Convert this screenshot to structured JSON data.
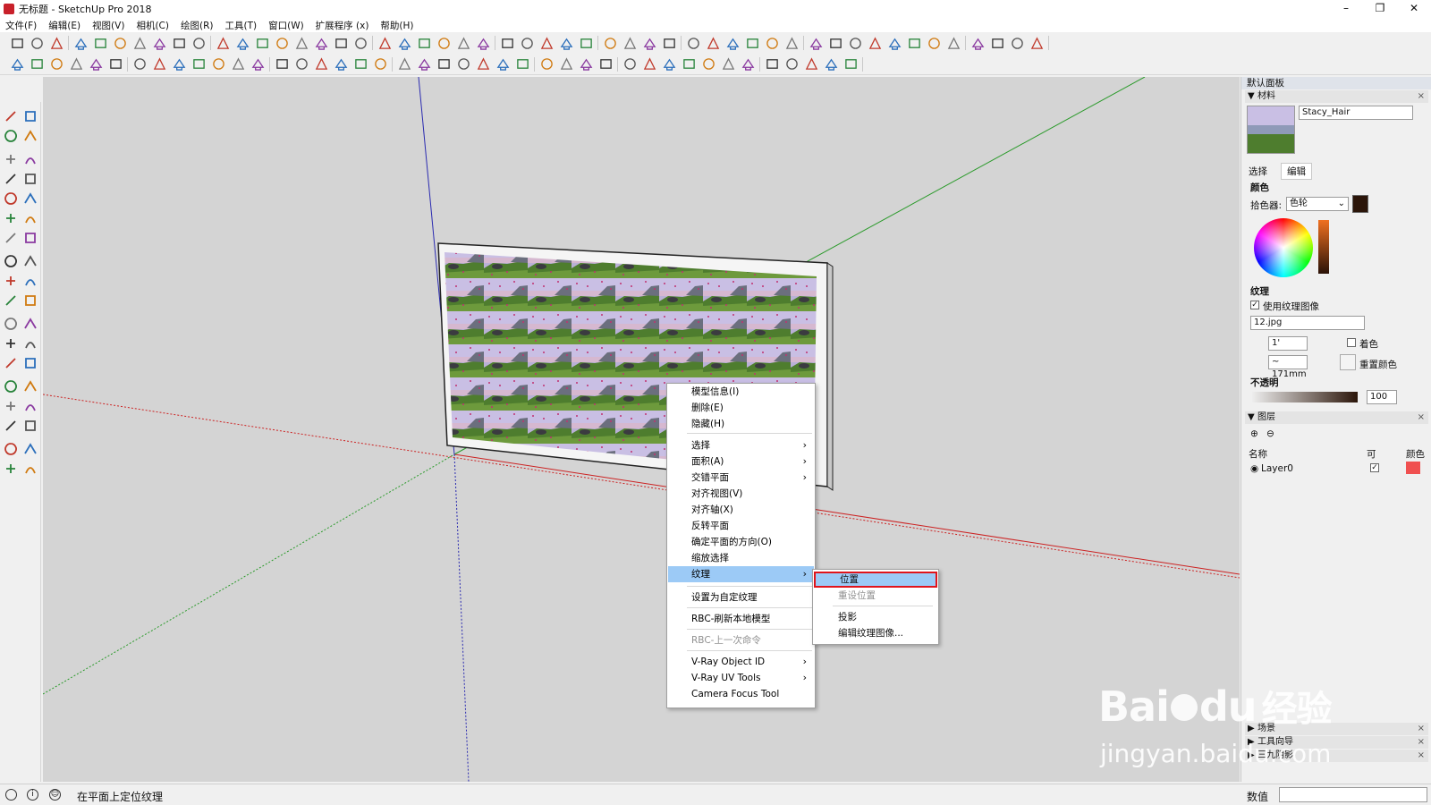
{
  "window": {
    "title": "无标题 - SketchUp Pro 2018",
    "min": "–",
    "restore": "❐",
    "close": "✕"
  },
  "menu": [
    "文件(F)",
    "编辑(E)",
    "视图(V)",
    "相机(C)",
    "绘图(R)",
    "工具(T)",
    "窗口(W)",
    "扩展程序 (x)",
    "帮助(H)"
  ],
  "context_menu": {
    "items": [
      "模型信息(I)",
      "删除(E)",
      "隐藏(H)",
      "选择",
      "面积(A)",
      "交错平面",
      "对齐视图(V)",
      "对齐轴(X)",
      "反转平面",
      "确定平面的方向(O)",
      "缩放选择",
      "纹理",
      "设置为自定纹理",
      "RBC-刷新本地模型",
      "RBC-上一次命令",
      "V-Ray Object ID",
      "V-Ray UV Tools",
      "Camera Focus Tool"
    ],
    "arrow": "›"
  },
  "submenu": {
    "items": [
      "位置",
      "重设位置",
      "投影",
      "编辑纹理图像..."
    ]
  },
  "right_panel": {
    "title": "默认面板",
    "materials_header": "材料",
    "material_name": "Stacy_Hair",
    "tabs": [
      "选择",
      "编辑"
    ],
    "color_label": "颜色",
    "picker_label": "拾色器:",
    "picker_value": "色轮",
    "texture_label": "纹理",
    "use_texture_label": "使用纹理图像",
    "texture_file": "12.jpg",
    "width_value": "1'",
    "height_value": "~ 171mm",
    "colorize_label": "着色",
    "reset_color_label": "重置颜色",
    "opacity_label": "不透明",
    "opacity_value": "100",
    "layers_header": "图层",
    "layers_cols": [
      "名称",
      "可",
      "颜色"
    ],
    "layer_name": "Layer0",
    "scenes_header": "场景",
    "tools_header": "工具向导",
    "shadow_header": "三九阴影",
    "value_label": "数值",
    "chk": "✓"
  },
  "status": {
    "text": "在平面上定位纹理",
    "info": "i",
    "user": "☺"
  },
  "watermark": {
    "brand": "Bai",
    "brand2": "du",
    "brand3": "经验",
    "url": "jingyan.baidu.com"
  },
  "colors": {
    "red_axis": "#cc2222",
    "green_axis": "#2a9a2a",
    "blue_axis": "#2a2ab0",
    "highlight": "#9ccaf6",
    "callout": "#e0141c",
    "layer_color": "#f05050"
  }
}
